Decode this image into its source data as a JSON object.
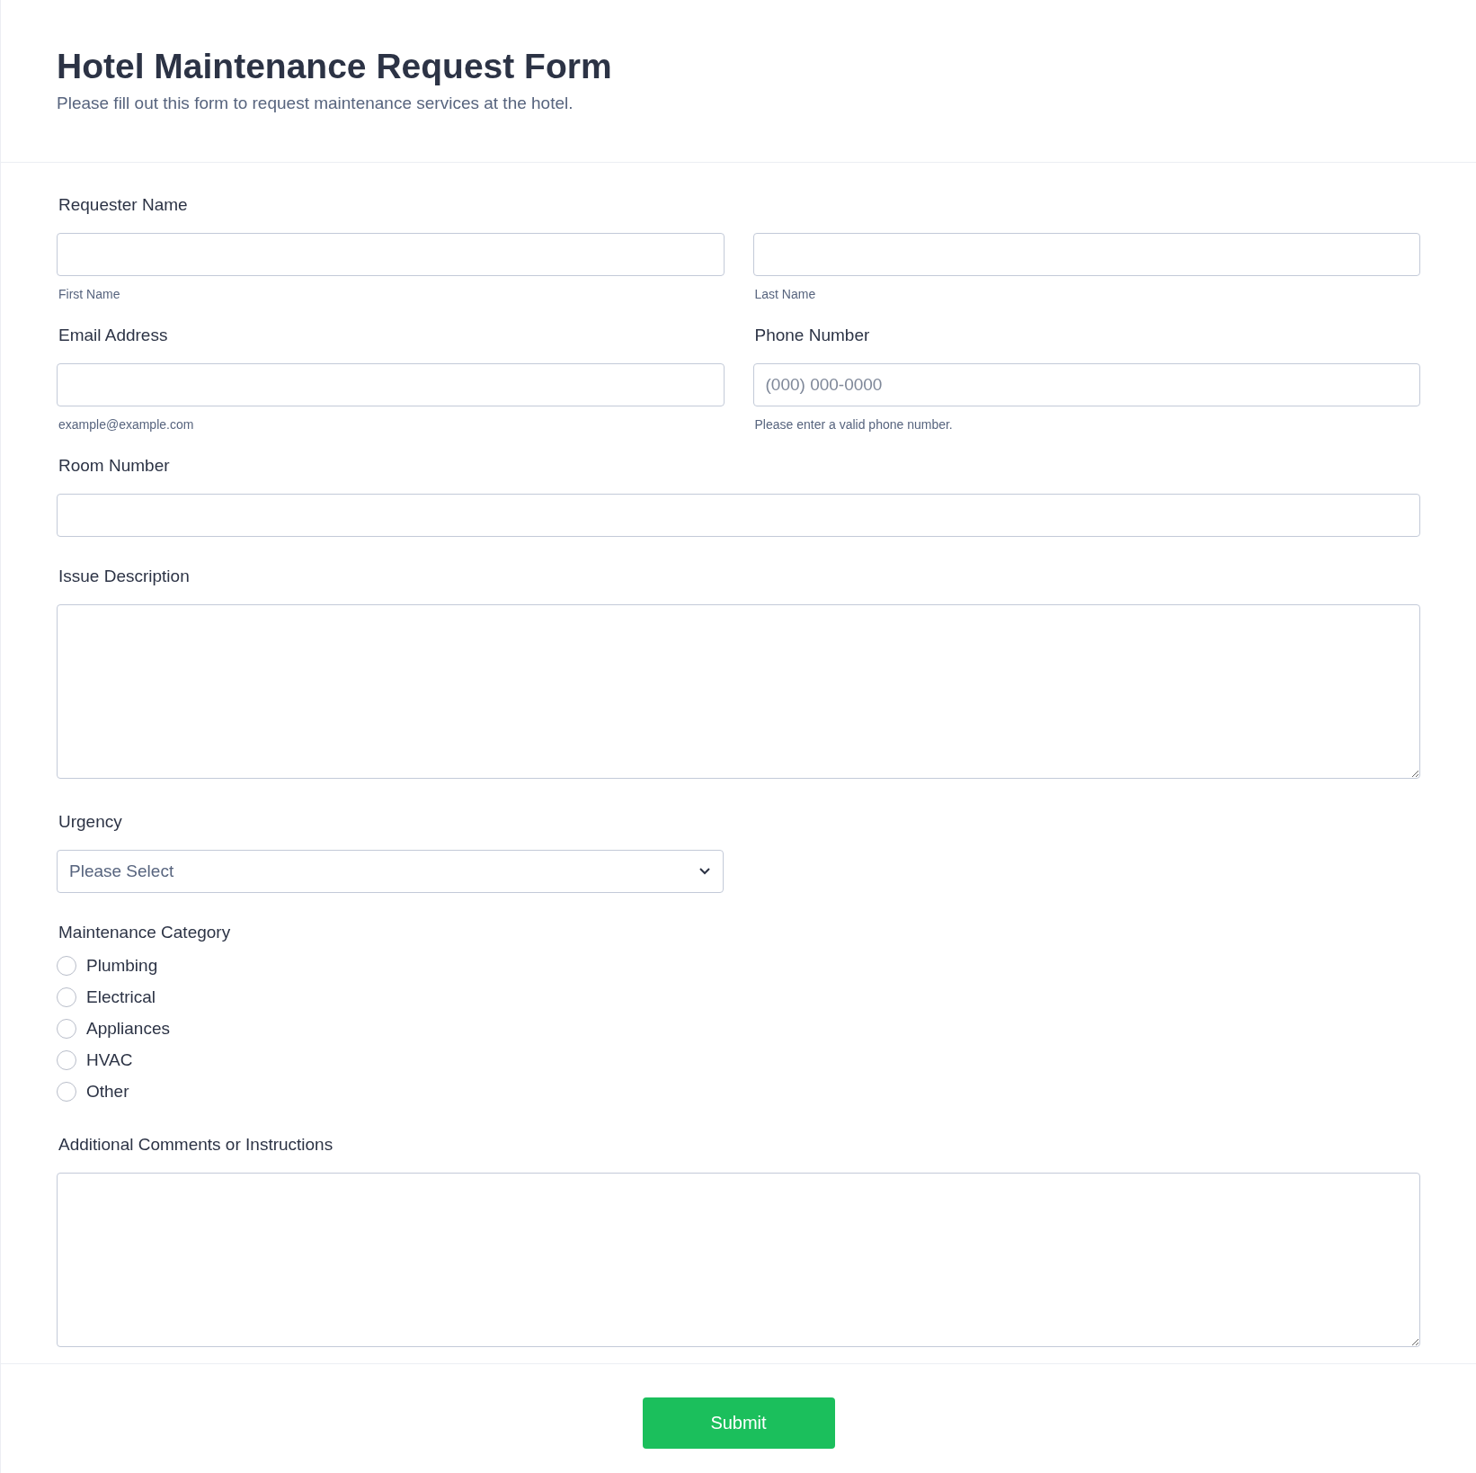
{
  "header": {
    "title": "Hotel Maintenance Request Form",
    "subtitle": "Please fill out this form to request maintenance services at the hotel."
  },
  "requester_name": {
    "label": "Requester Name",
    "first": {
      "sublabel": "First Name"
    },
    "last": {
      "sublabel": "Last Name"
    }
  },
  "email": {
    "label": "Email Address",
    "sublabel": "example@example.com"
  },
  "phone": {
    "label": "Phone Number",
    "placeholder": "(000) 000-0000",
    "sublabel": "Please enter a valid phone number."
  },
  "room": {
    "label": "Room Number"
  },
  "issue": {
    "label": "Issue Description"
  },
  "urgency": {
    "label": "Urgency",
    "placeholder": "Please Select"
  },
  "category": {
    "label": "Maintenance Category",
    "options": [
      {
        "label": "Plumbing",
        "selected": false
      },
      {
        "label": "Electrical",
        "selected": false
      },
      {
        "label": "Appliances",
        "selected": false
      },
      {
        "label": "HVAC",
        "selected": false
      },
      {
        "label": "Other",
        "selected": false
      }
    ]
  },
  "comments": {
    "label": "Additional Comments or Instructions"
  },
  "submit": {
    "label": "Submit"
  }
}
